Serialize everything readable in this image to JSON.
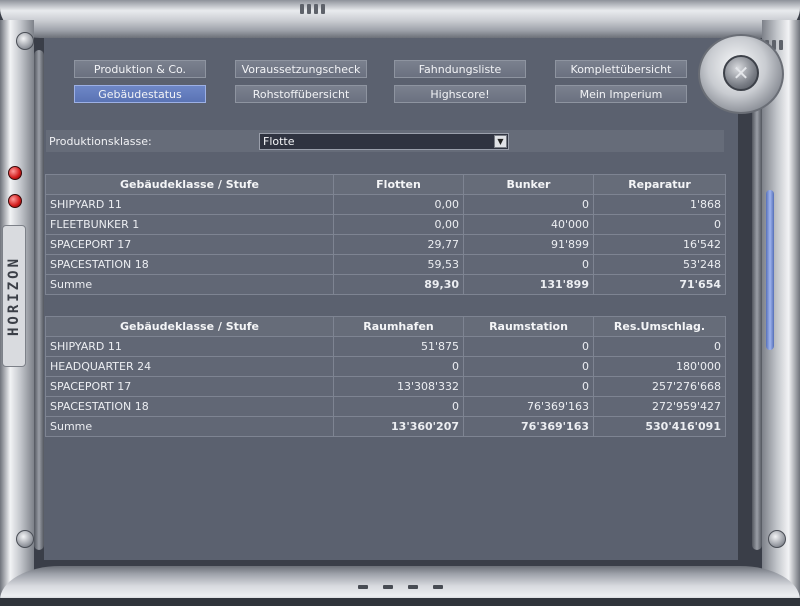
{
  "nav": {
    "row1": [
      "Produktion & Co.",
      "Voraussetzungscheck",
      "Fahndungsliste",
      "Komplettübersicht"
    ],
    "row2": [
      "Gebäudestatus",
      "Rohstoffübersicht",
      "Highscore!",
      "Mein Imperium"
    ],
    "active": "Gebäudestatus"
  },
  "production_class": {
    "label": "Produktionsklasse:",
    "selected": "Flotte"
  },
  "table1": {
    "headers": [
      "Gebäudeklasse / Stufe",
      "Flotten",
      "Bunker",
      "Reparatur"
    ],
    "rows": [
      [
        "SHIPYARD 11",
        "0,00",
        "0",
        "1'868"
      ],
      [
        "FLEETBUNKER 1",
        "0,00",
        "40'000",
        "0"
      ],
      [
        "SPACEPORT 17",
        "29,77",
        "91'899",
        "16'542"
      ],
      [
        "SPACESTATION 18",
        "59,53",
        "0",
        "53'248"
      ]
    ],
    "sum": [
      "Summe",
      "89,30",
      "131'899",
      "71'654"
    ]
  },
  "table2": {
    "headers": [
      "Gebäudeklasse / Stufe",
      "Raumhafen",
      "Raumstation",
      "Res.Umschlag."
    ],
    "rows": [
      [
        "SHIPYARD 11",
        "51'875",
        "0",
        "0"
      ],
      [
        "HEADQUARTER 24",
        "0",
        "0",
        "180'000"
      ],
      [
        "SPACEPORT 17",
        "13'308'332",
        "0",
        "257'276'668"
      ],
      [
        "SPACESTATION 18",
        "0",
        "76'369'163",
        "272'959'427"
      ]
    ],
    "sum": [
      "Summe",
      "13'360'207",
      "76'369'163",
      "530'416'091"
    ]
  },
  "brand": "HORIZON",
  "icons": {
    "close": "close-icon",
    "dropdown": "chevron-down-icon"
  },
  "colors": {
    "panel": "#5b616f",
    "active_button": "#6e87c7",
    "led": "#d21a1a"
  }
}
